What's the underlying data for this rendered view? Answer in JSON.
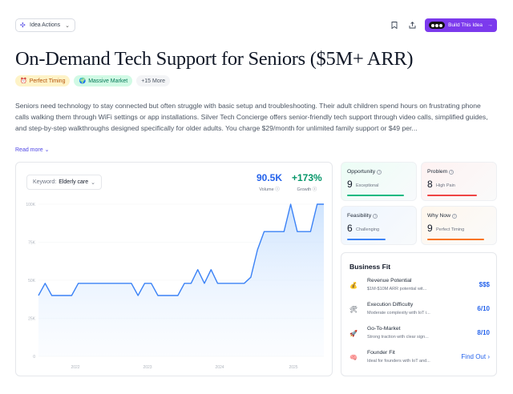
{
  "toolbar": {
    "idea_actions_label": "Idea Actions",
    "build_label": "Build This Idea"
  },
  "title": "On-Demand Tech Support for Seniors ($5M+ ARR)",
  "tags": [
    {
      "icon": "⏰",
      "label": "Perfect Timing"
    },
    {
      "icon": "🌍",
      "label": "Massive Market"
    },
    {
      "label": "+15 More"
    }
  ],
  "description": "Seniors need technology to stay connected but often struggle with basic setup and troubleshooting. Their adult children spend hours on frustrating phone calls walking them through WiFi settings or app installations. Silver Tech Concierge offers senior-friendly tech support through video calls, simplified guides, and step-by-step walkthroughs designed specifically for older adults. You charge $29/month for unlimited family support or $49 per...",
  "read_more": "Read more",
  "keyword": {
    "prefix": "Keyword:",
    "value": "Elderly care"
  },
  "metrics": {
    "volume": {
      "value": "90.5K",
      "label": "Volume",
      "color": "#2563eb"
    },
    "growth": {
      "value": "+173%",
      "label": "Growth",
      "color": "#059669"
    }
  },
  "chart_data": {
    "type": "area",
    "y_ticks": [
      "100K",
      "75K",
      "50K",
      "25K",
      "0"
    ],
    "x_ticks": [
      "2022",
      "2023",
      "2024",
      "2025"
    ],
    "ylim": [
      0,
      100
    ],
    "values": [
      40,
      48,
      40,
      40,
      40,
      40,
      48,
      48,
      48,
      48,
      48,
      48,
      48,
      48,
      48,
      40,
      48,
      48,
      40,
      40,
      40,
      40,
      48,
      48,
      57,
      48,
      57,
      48,
      48,
      48,
      48,
      48,
      52,
      70,
      82,
      82,
      82,
      82,
      100,
      82,
      82,
      82,
      100,
      100
    ],
    "line_color": "#3b82f6"
  },
  "scores": {
    "opportunity": {
      "title": "Opportunity",
      "value": "9",
      "label": "Exceptional"
    },
    "problem": {
      "title": "Problem",
      "value": "8",
      "label": "High Pain"
    },
    "feasibility": {
      "title": "Feasibility",
      "value": "6",
      "label": "Challenging"
    },
    "why_now": {
      "title": "Why Now",
      "value": "9",
      "label": "Perfect Timing"
    }
  },
  "business_fit": {
    "title": "Business Fit",
    "rows": [
      {
        "icon": "💰",
        "title": "Revenue Potential",
        "sub": "$1M-$10M ARR potential wit...",
        "value": "$$$"
      },
      {
        "icon": "🛠",
        "title": "Execution Difficulty",
        "sub": "Moderate complexity with IoT i...",
        "value": "6/10"
      },
      {
        "icon": "🚀",
        "title": "Go-To-Market",
        "sub": "Strong traction with clear sign...",
        "value": "8/10"
      },
      {
        "icon": "🧠",
        "title": "Founder Fit",
        "sub": "Ideal for founders with IoT and...",
        "value": "Find Out ›"
      }
    ]
  }
}
